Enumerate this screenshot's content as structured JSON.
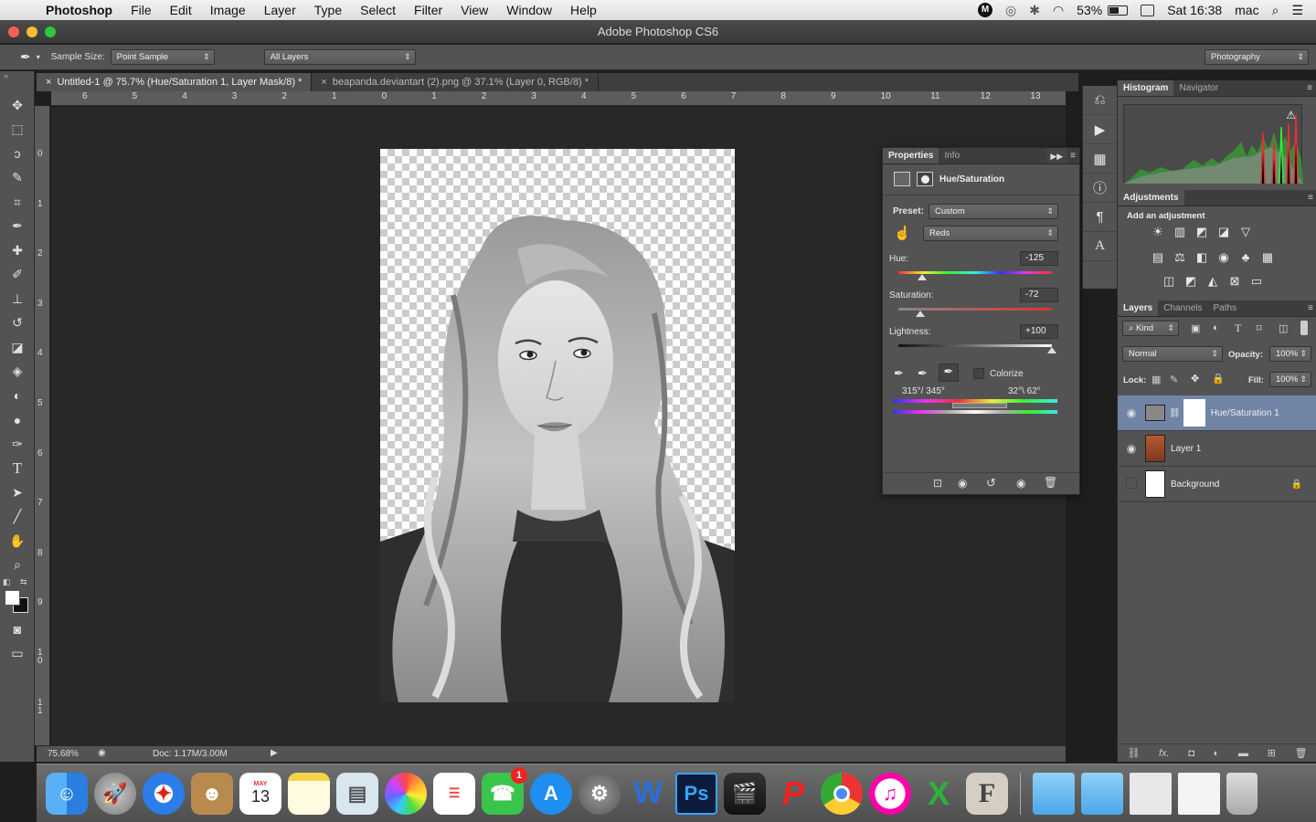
{
  "menubar": {
    "app": "Photoshop",
    "items": [
      "File",
      "Edit",
      "Image",
      "Layer",
      "Type",
      "Select",
      "Filter",
      "View",
      "Window",
      "Help"
    ],
    "battery": "53%",
    "clock": "Sat 16:38",
    "user": "mac"
  },
  "window": {
    "title": "Adobe Photoshop CS6"
  },
  "options": {
    "sample_size_label": "Sample Size:",
    "sample_size_value": "Point Sample",
    "layers_value": "All Layers",
    "workspace": "Photography"
  },
  "tabs": [
    {
      "label": "Untitled-1 @ 75.7% (Hue/Saturation 1, Layer Mask/8) *"
    },
    {
      "label": "beapanda.deviantart (2).png @ 37.1% (Layer 0, RGB/8) *"
    }
  ],
  "ruler": {
    "h": [
      "6",
      "5",
      "4",
      "3",
      "2",
      "1",
      "0",
      "1",
      "2",
      "3",
      "4",
      "5",
      "6",
      "7",
      "8",
      "9",
      "10",
      "11",
      "12",
      "13"
    ],
    "v": [
      "0",
      "1",
      "2",
      "3",
      "4",
      "5",
      "6",
      "7",
      "8",
      "9",
      "1\n0",
      "1\n1"
    ]
  },
  "status": {
    "zoom": "75.68%",
    "doc": "Doc: 1.17M/3.00M"
  },
  "properties": {
    "tabs": [
      "Properties",
      "Info"
    ],
    "title": "Hue/Saturation",
    "preset_label": "Preset:",
    "preset_value": "Custom",
    "channel_value": "Reds",
    "hue_label": "Hue:",
    "hue_value": "-125",
    "saturation_label": "Saturation:",
    "saturation_value": "-72",
    "lightness_label": "Lightness:",
    "lightness_value": "+100",
    "colorize_label": "Colorize",
    "range_left": "315°/ 345°",
    "range_right": "32°\\ 62°",
    "hue_fraction": 0.153,
    "saturation_fraction": 0.14,
    "lightness_fraction": 1.0
  },
  "histogram": {
    "tabs": [
      "Histogram",
      "Navigator"
    ]
  },
  "adjustments": {
    "tab": "Adjustments",
    "add_label": "Add an adjustment"
  },
  "layers_panel": {
    "tabs": [
      "Layers",
      "Channels",
      "Paths"
    ],
    "kind": "Kind",
    "blend": "Normal",
    "opacity_label": "Opacity:",
    "opacity": "100%",
    "lock_label": "Lock:",
    "fill_label": "Fill:",
    "fill": "100%",
    "layers": [
      {
        "name": "Hue/Saturation 1",
        "selected": true
      },
      {
        "name": "Layer 1",
        "selected": false
      },
      {
        "name": "Background",
        "selected": false
      }
    ]
  },
  "dock": {
    "calendar_month": "MAY",
    "calendar_day": "13",
    "facetime_badge": "1",
    "ps_label": "Ps",
    "word_label": "W",
    "excel_label": "X",
    "ftp_label": "F"
  },
  "colors": {
    "panel": "#535353",
    "selected_layer": "#7184a6",
    "canvas_bg": "#282828"
  }
}
